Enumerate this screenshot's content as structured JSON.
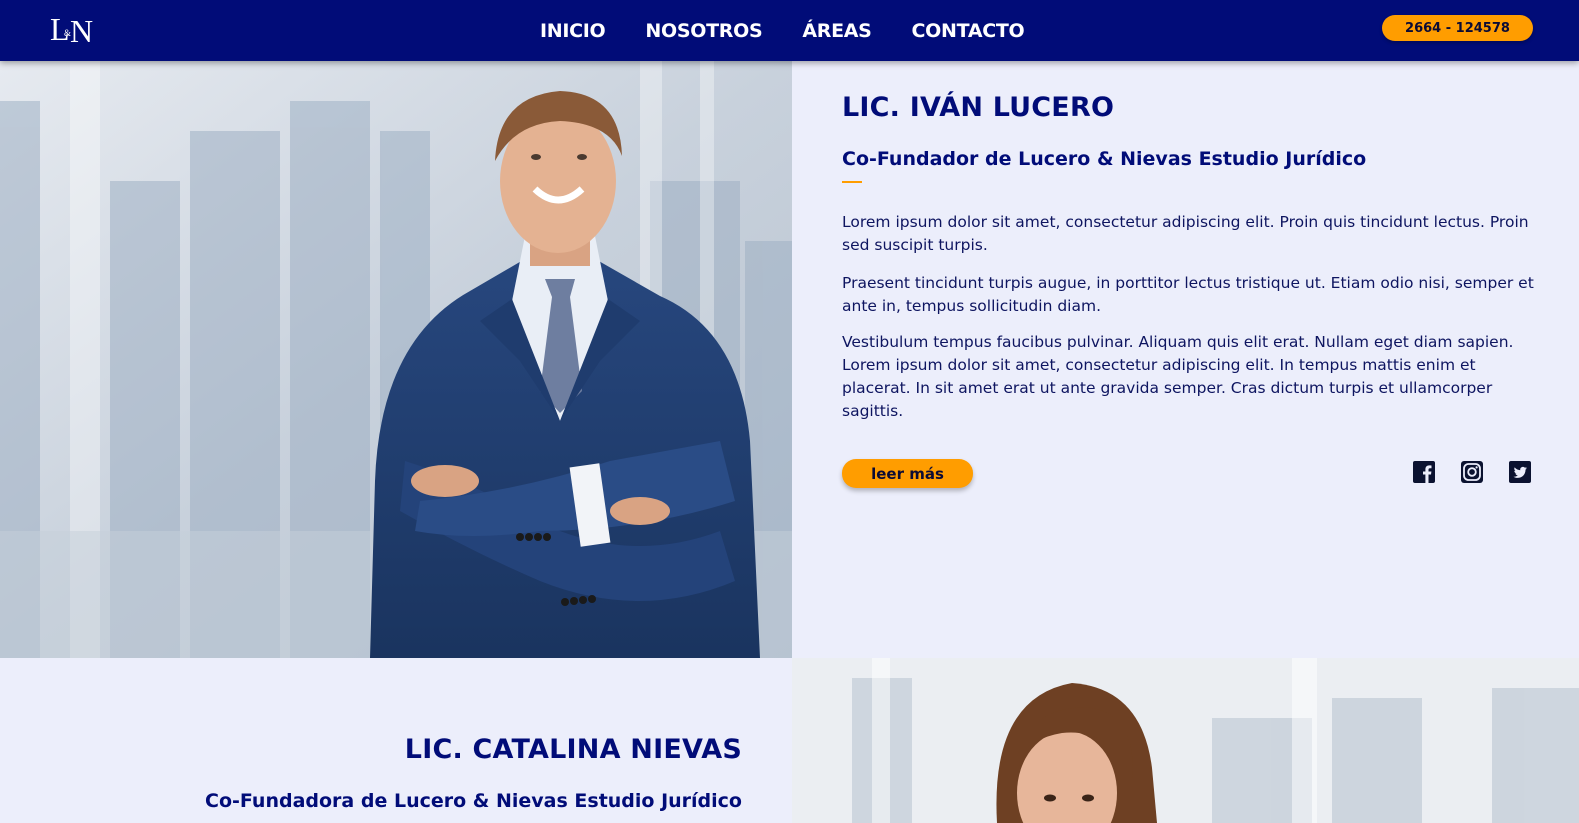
{
  "header": {
    "logo_text": "L&N",
    "nav": [
      "INICIO",
      "NOSOTROS",
      "ÁREAS",
      "CONTACTO"
    ],
    "phone": "2664 - 124578"
  },
  "profile_1": {
    "name": "LIC. IVÁN LUCERO",
    "role": "Co-Fundador de Lucero & Nievas Estudio Jurídico",
    "paragraphs": [
      "Lorem ipsum dolor sit amet, consectetur adipiscing elit. Proin quis tincidunt lectus. Proin sed suscipit turpis.",
      "Praesent tincidunt turpis augue, in porttitor lectus tristique ut. Etiam odio nisi, semper et ante in, tempus sollicitudin diam.",
      "Vestibulum tempus faucibus pulvinar. Aliquam quis elit erat. Nullam eget diam sapien. Lorem ipsum dolor sit amet, consectetur adipiscing elit. In tempus mattis enim et placerat. In sit amet erat ut ante gravida semper. Cras dictum turpis et ullamcorper sagittis."
    ],
    "read_more": "leer más",
    "social_icons": [
      "facebook-icon",
      "instagram-icon",
      "twitter-icon"
    ]
  },
  "profile_2": {
    "name": "LIC. CATALINA NIEVAS",
    "role": "Co-Fundadora de Lucero & Nievas Estudio Jurídico"
  },
  "colors": {
    "navy": "#010c78",
    "orange": "#ff9d00",
    "panel": "#eceefb"
  }
}
